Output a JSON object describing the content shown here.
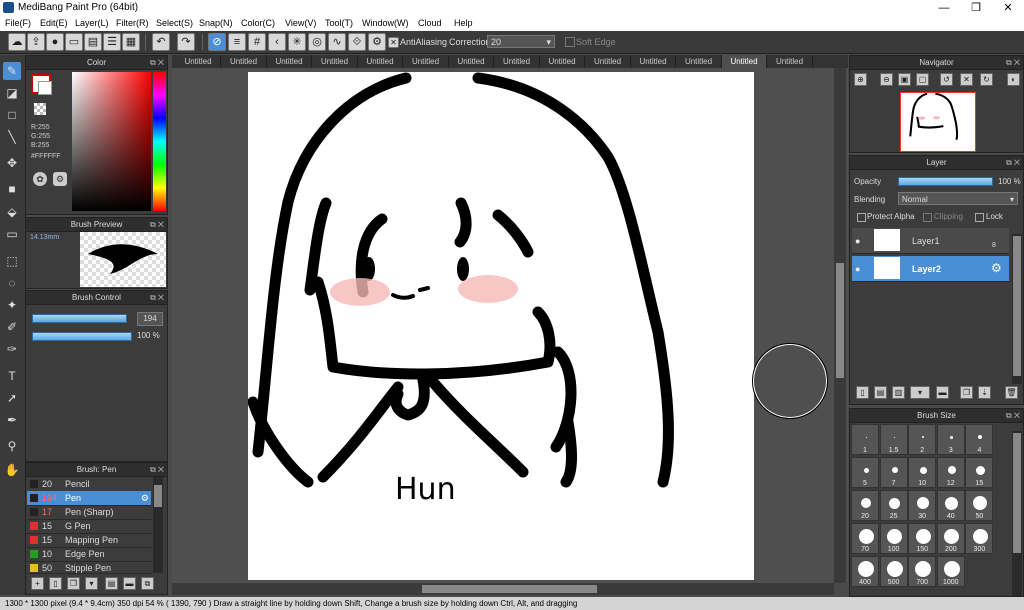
{
  "window": {
    "title": "MediBang Paint Pro (64bit)",
    "minimize": "—",
    "maximize": "❐",
    "close": "✕"
  },
  "menu": [
    "File(F)",
    "Edit(E)",
    "Layer(L)",
    "Filter(R)",
    "Select(S)",
    "Snap(N)",
    "Color(C)",
    "View(V)",
    "Tool(T)",
    "Window(W)",
    "Cloud",
    "Help"
  ],
  "toolbar": {
    "antialiasing_label": "AntiAliasing",
    "correction_label": "Correction",
    "correction_value": "20",
    "soft_edge_label": "Soft Edge"
  },
  "tabs": [
    "Untitled",
    "Untitled",
    "Untitled",
    "Untitled",
    "Untitled",
    "Untitled",
    "Untitled",
    "Untitled",
    "Untitled",
    "Untitled",
    "Untitled",
    "Untitled",
    "Untitled",
    "Untitled"
  ],
  "color_panel": {
    "title": "Color",
    "r": "R:255",
    "g": "G:255",
    "b": "B:255",
    "hex": "#FFFFFF"
  },
  "brush_preview": {
    "title": "Brush Preview",
    "size": "14.13mm"
  },
  "brush_control": {
    "title": "Brush Control",
    "size_value": "194",
    "opacity_value": "100 %",
    "size_fill": 0.95,
    "opacity_fill": 1.0
  },
  "brush_list": {
    "title": "Brush: Pen",
    "items": [
      {
        "size": "20",
        "name": "Pencil",
        "color": "#333333"
      },
      {
        "size": "194",
        "name": "Pen",
        "color": "#333333",
        "selected": true
      },
      {
        "size": "17",
        "name": "Pen (Sharp)",
        "color": "#333333"
      },
      {
        "size": "15",
        "name": "G Pen",
        "color": "#e03030"
      },
      {
        "size": "15",
        "name": "Mapping Pen",
        "color": "#e03030"
      },
      {
        "size": "10",
        "name": "Edge Pen",
        "color": "#20a020"
      },
      {
        "size": "50",
        "name": "Stipple Pen",
        "color": "#e0c020"
      }
    ]
  },
  "navigator": {
    "title": "Navigator"
  },
  "layer_panel": {
    "title": "Layer",
    "opacity_label": "Opacity",
    "opacity_value": "100 %",
    "opacity_fill": 1.0,
    "blending_label": "Blending",
    "blending_value": "Normal",
    "protect_alpha": "Protect Alpha",
    "clipping": "Clipping",
    "lock": "Lock",
    "layers": [
      {
        "name": "Layer1",
        "badge": "8"
      },
      {
        "name": "Layer2"
      }
    ]
  },
  "brush_size": {
    "title": "Brush Size",
    "sizes": [
      "1",
      "1.5",
      "2",
      "3",
      "4",
      "5",
      "7",
      "10",
      "12",
      "15",
      "20",
      "25",
      "30",
      "40",
      "50",
      "70",
      "100",
      "150",
      "200",
      "300",
      "400",
      "500",
      "700",
      "1000"
    ]
  },
  "status": {
    "text": "1300 * 1300 pixel  (9.4 * 9.4cm)  350 dpi  54 %  ( 1390, 790 )  Draw a straight line by holding down Shift, Change a brush size by holding down Ctrl, Alt, and dragging"
  },
  "drawing": {
    "signature": "Hun"
  },
  "colors": {
    "accent": "#4a8fd6",
    "panel": "#3c3c3c",
    "blush": "#f7b8b8"
  }
}
